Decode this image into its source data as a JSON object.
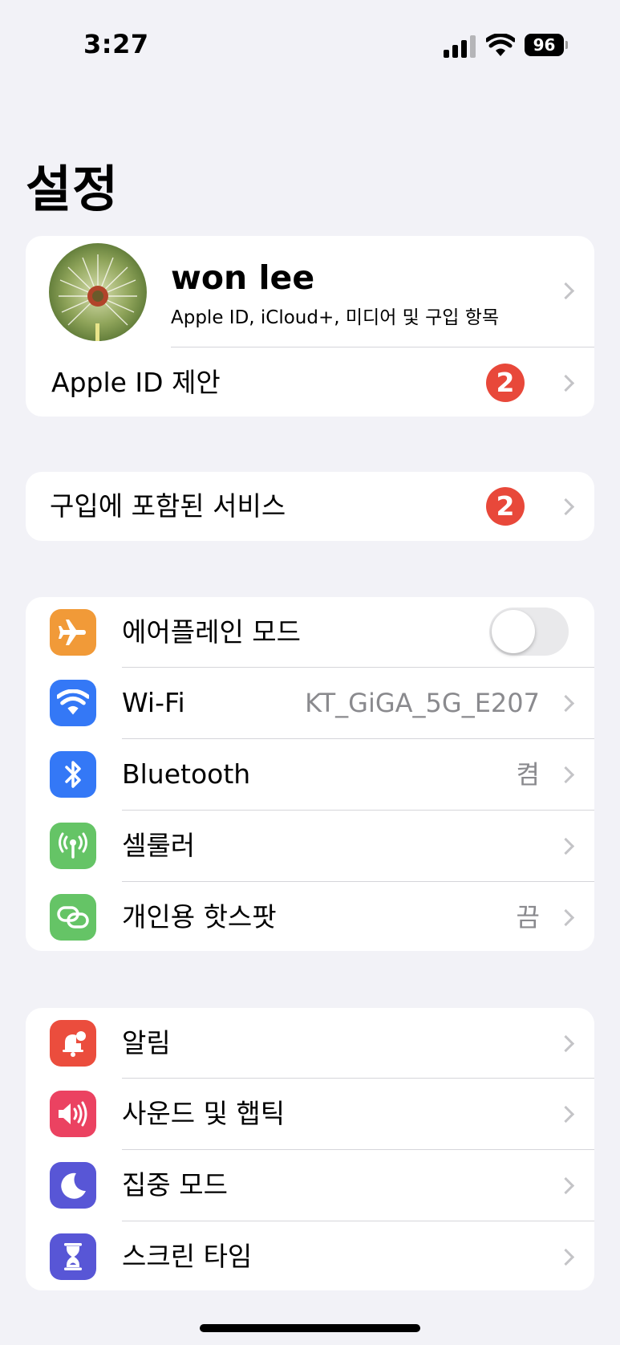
{
  "status_bar": {
    "time": "3:27",
    "battery_level": "96",
    "icons": [
      "signal-icon",
      "wifi-icon",
      "battery-icon"
    ]
  },
  "page_title": "설정",
  "profile": {
    "name": "won lee",
    "subtitle": "Apple ID, iCloud+, 미디어 및 구입 항목",
    "suggestions_label": "Apple ID 제안",
    "suggestions_badge": "2"
  },
  "services": {
    "label": "구입에 포함된 서비스",
    "badge": "2"
  },
  "connectivity": {
    "airplane": {
      "label": "에어플레인 모드",
      "enabled": false,
      "icon": "airplane-icon",
      "color": "#f19a38"
    },
    "wifi": {
      "label": "Wi-Fi",
      "value": "KT_GiGA_5G_E207",
      "icon": "wifi-icon",
      "color": "#3478f6"
    },
    "bluetooth": {
      "label": "Bluetooth",
      "value": "켬",
      "icon": "bluetooth-icon",
      "color": "#3478f6"
    },
    "cellular": {
      "label": "셀룰러",
      "icon": "cellular-antenna-icon",
      "color": "#65c466"
    },
    "hotspot": {
      "label": "개인용 핫스팟",
      "value": "끔",
      "icon": "hotspot-link-icon",
      "color": "#65c466"
    }
  },
  "notifications_group": {
    "notifications": {
      "label": "알림",
      "icon": "bell-badge-icon",
      "color": "#eb4d3d"
    },
    "sounds": {
      "label": "사운드 및 햅틱",
      "icon": "speaker-icon",
      "color": "#eb4261"
    },
    "focus": {
      "label": "집중 모드",
      "icon": "moon-icon",
      "color": "#5856d6"
    },
    "screen_time": {
      "label": "스크린 타임",
      "icon": "hourglass-icon",
      "color": "#5856d6"
    }
  }
}
